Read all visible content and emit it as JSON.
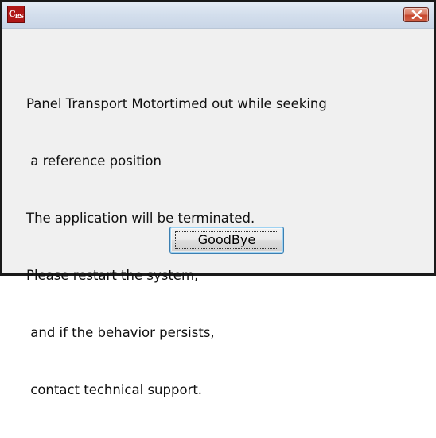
{
  "window": {
    "app_icon_text": "C",
    "app_icon_sub": "RS",
    "close_icon": "close-x-icon"
  },
  "dialog": {
    "message_lines": [
      "Panel Transport Motortimed out while seeking",
      " a reference position",
      "The application will be terminated.",
      "Please restart the system,",
      " and if the behavior persists,",
      " contact technical support."
    ],
    "button_label": "GoodBye"
  },
  "colors": {
    "close_button": "#c7472d",
    "app_icon": "#b01818",
    "focus_border": "#3c7fb1"
  }
}
